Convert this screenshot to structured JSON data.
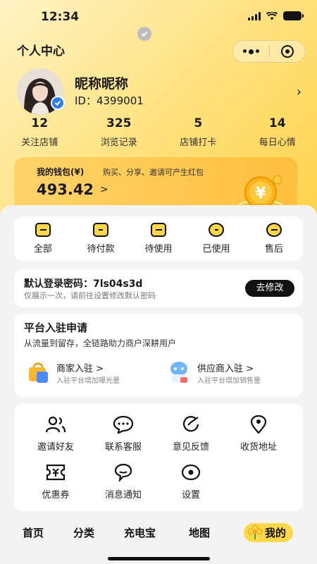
{
  "status_bar": {
    "time": "12:34"
  },
  "header": {
    "title": "个人中心"
  },
  "profile": {
    "nickname": "昵称昵称",
    "id": "ID：4399001"
  },
  "stats": [
    {
      "value": "12",
      "label": "关注店铺"
    },
    {
      "value": "325",
      "label": "浏览记录"
    },
    {
      "value": "5",
      "label": "店铺打卡"
    },
    {
      "value": "14",
      "label": "每日心情"
    }
  ],
  "wallet": {
    "label": "我的钱包(¥)",
    "desc": "购买、分享、邀请可产生红包",
    "amount": "493.42",
    "arrow": ">"
  },
  "orders": [
    {
      "label": "全部",
      "icon": "order-all-icon"
    },
    {
      "label": "待付款",
      "icon": "wallet-card-icon"
    },
    {
      "label": "待使用",
      "icon": "ticket-icon"
    },
    {
      "label": "已使用",
      "icon": "clock-icon"
    },
    {
      "label": "售后",
      "icon": "exchange-icon"
    }
  ],
  "password": {
    "title": "默认登录密码：7ls04s3d",
    "subtitle": "仅展示一次，请前往设置修改默认密码",
    "button": "去修改"
  },
  "platform": {
    "title": "平台入驻申请",
    "subtitle": "从流量到留存，全链路助力商户深耕用户",
    "merchant": {
      "title": "商家入驻 >",
      "desc": "入驻平台增加曝光量"
    },
    "supplier": {
      "title": "供应商入驻 >",
      "desc": "入驻平台增加销售量"
    }
  },
  "services": [
    {
      "label": "邀请好友",
      "icon": "invite-friends-icon"
    },
    {
      "label": "联系客服",
      "icon": "chat-bubble-icon"
    },
    {
      "label": "意见反馈",
      "icon": "feedback-icon"
    },
    {
      "label": "收货地址",
      "icon": "location-pin-icon"
    },
    {
      "label": "优惠券",
      "icon": "coupon-icon"
    },
    {
      "label": "消息通知",
      "icon": "message-icon"
    },
    {
      "label": "设置",
      "icon": "settings-eye-icon"
    }
  ],
  "tabbar": {
    "home": "首页",
    "category": "分类",
    "charge": "充电宝",
    "map": "地图",
    "mine": "我的"
  },
  "colors": {
    "accent": "#ffd84a",
    "background": "#f3f3f3",
    "verify": "#2b7cf5"
  }
}
